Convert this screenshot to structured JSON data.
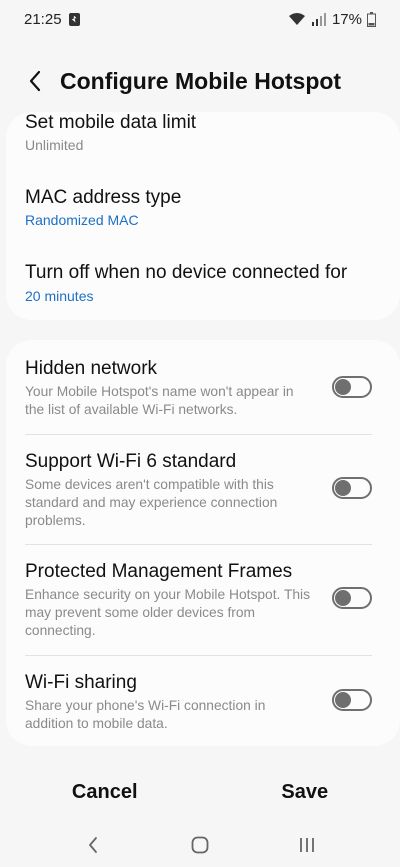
{
  "status_bar": {
    "time": "21:25",
    "battery": "17%",
    "icons": [
      "notification-icon",
      "wifi-icon",
      "signal-icon",
      "battery-icon"
    ]
  },
  "header": {
    "title": "Configure Mobile Hotspot",
    "back_icon": "back-arrow-icon"
  },
  "card1": {
    "items": [
      {
        "title": "Set mobile data limit",
        "value": "Unlimited"
      },
      {
        "title": "MAC address type",
        "value": "Randomized MAC"
      },
      {
        "title": "Turn off when no device connected for",
        "value": "20 minutes"
      }
    ]
  },
  "card2": {
    "items": [
      {
        "title": "Hidden network",
        "desc": "Your Mobile Hotspot's name won't appear in the list of available Wi-Fi networks.",
        "enabled": false
      },
      {
        "title": "Support Wi-Fi 6 standard",
        "desc": "Some devices aren't compatible with this standard and may experience connection problems.",
        "enabled": false
      },
      {
        "title": "Protected Management Frames",
        "desc": "Enhance security on your Mobile Hotspot. This may prevent some older devices from connecting.",
        "enabled": false
      },
      {
        "title": "Wi-Fi sharing",
        "desc": "Share your phone's Wi-Fi connection in addition to mobile data.",
        "enabled": false
      }
    ]
  },
  "actions": {
    "cancel": "Cancel",
    "save": "Save"
  },
  "nav": {
    "icons": [
      "nav-back-icon",
      "nav-home-icon",
      "nav-recents-icon"
    ]
  },
  "colors": {
    "background": "#f6f6f6",
    "card": "#fcfcfc",
    "accent_blue": "#1e6fc4",
    "secondary_text": "#8a8a8a"
  }
}
